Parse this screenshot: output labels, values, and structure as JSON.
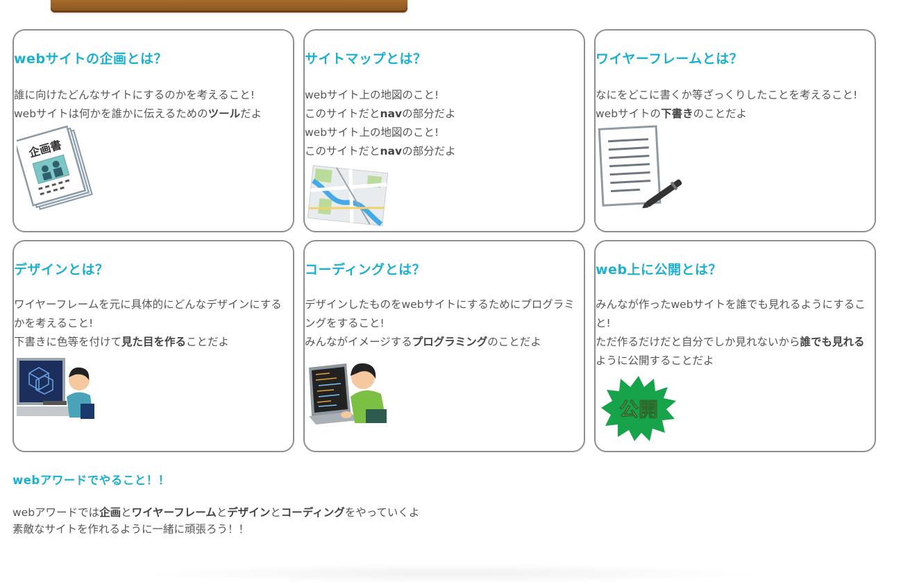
{
  "cards": [
    {
      "title": "webサイトの企画とは？",
      "lines": [
        {
          "a": "誰に向けたどんなサイトにするのかを考えること!",
          "b": "",
          "c": ""
        },
        {
          "a": "webサイトは何かを誰かに伝えるための",
          "b": "ツール",
          "c": "だよ"
        }
      ],
      "icon": "plan-document-icon",
      "icon_text": "企画書"
    },
    {
      "title": "サイトマップとは？",
      "lines": [
        {
          "a": "webサイト上の地図のこと!",
          "b": "",
          "c": ""
        },
        {
          "a": "このサイトだと",
          "b": "nav",
          "c": "の部分だよ"
        },
        {
          "a": "webサイト上の地図のこと!",
          "b": "",
          "c": ""
        },
        {
          "a": "このサイトだと",
          "b": "nav",
          "c": "の部分だよ"
        }
      ],
      "icon": "map-icon"
    },
    {
      "title": "ワイヤーフレームとは？",
      "lines": [
        {
          "a": "なにをどこに書くか等ざっくりしたことを考えること!",
          "b": "",
          "c": ""
        },
        {
          "a": "webサイトの",
          "b": "下書き",
          "c": "のことだよ"
        }
      ],
      "icon": "paper-and-pen-icon"
    },
    {
      "title": "デザインとは？",
      "lines": [
        {
          "a": "ワイヤーフレームを元に具体的にどんなデザインにするかを考えること!",
          "b": "",
          "c": ""
        },
        {
          "a": "下書きに色等を付けて",
          "b": "見た目を作る",
          "c": "ことだよ"
        }
      ],
      "icon": "designer-at-computer-icon"
    },
    {
      "title": "コーディングとは？",
      "lines": [
        {
          "a": "デザインしたものをwebサイトにするためにプログラミングをすること!",
          "b": "",
          "c": ""
        },
        {
          "a": "みんながイメージする",
          "b": "プログラミング",
          "c": "のことだよ"
        }
      ],
      "icon": "programmer-at-laptop-icon"
    },
    {
      "title": "web上に公開とは？",
      "lines": [
        {
          "a": "みんなが作ったwebサイトを誰でも見れるようにすること!",
          "b": "",
          "c": ""
        },
        {
          "a": "ただ作るだけだと自分でしか見れないから",
          "b": "誰でも見れる",
          "c": "ように公開することだよ"
        }
      ],
      "icon": "publish-badge-icon",
      "icon_text": "公開"
    }
  ],
  "summary": {
    "title": "webアワードでやること！！",
    "line1": {
      "p1": "webアワードでは",
      "b1": "企画",
      "p2": "と",
      "b2": "ワイヤーフレーム",
      "p3": "と",
      "b3": "デザイン",
      "p4": "と",
      "b4": "コーディング",
      "p5": "をやっていくよ"
    },
    "line2": "素敵なサイトを作れるように一緒に頑張ろう！！"
  },
  "colors": {
    "accent": "#1bb0ce",
    "text": "#555555",
    "border": "#8e8e8e",
    "publish_badge": "#16a34a"
  }
}
